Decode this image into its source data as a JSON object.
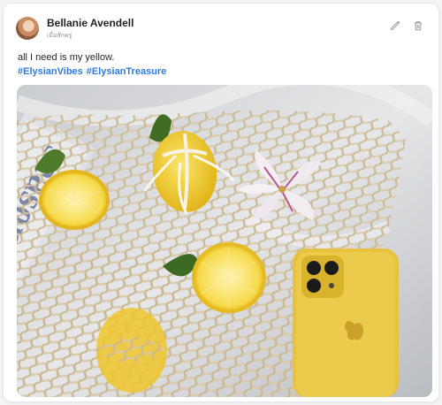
{
  "post": {
    "author_name": "Bellanie Avendell",
    "timestamp": "เมื่อสักครู่",
    "text": "all I need is my yellow.",
    "hashtags": [
      "#ElysianVibes",
      "#ElysianTreasure"
    ],
    "photo_caption_text": "seasons"
  },
  "icons": {
    "edit": "pencil-icon",
    "delete": "trash-icon"
  },
  "colors": {
    "hashtag": "#2f7bd8",
    "lemon": "#f2cf2a",
    "phone_case": "#e8c23f"
  }
}
